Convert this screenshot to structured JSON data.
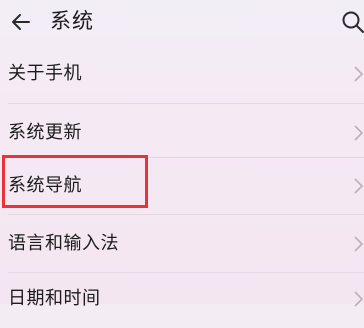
{
  "header": {
    "title": "系统"
  },
  "settings": {
    "items": [
      {
        "label": "关于手机"
      },
      {
        "label": "系统更新"
      },
      {
        "label": "系统导航"
      },
      {
        "label": "语言和输入法"
      },
      {
        "label": "日期和时间"
      }
    ]
  },
  "icons": {
    "back": "arrow-left-icon",
    "search": "search-icon",
    "chevron": "chevron-right-icon"
  },
  "colors": {
    "highlight": "#e8333b",
    "background": "#f4ecf3",
    "text": "#1c1c1c"
  }
}
